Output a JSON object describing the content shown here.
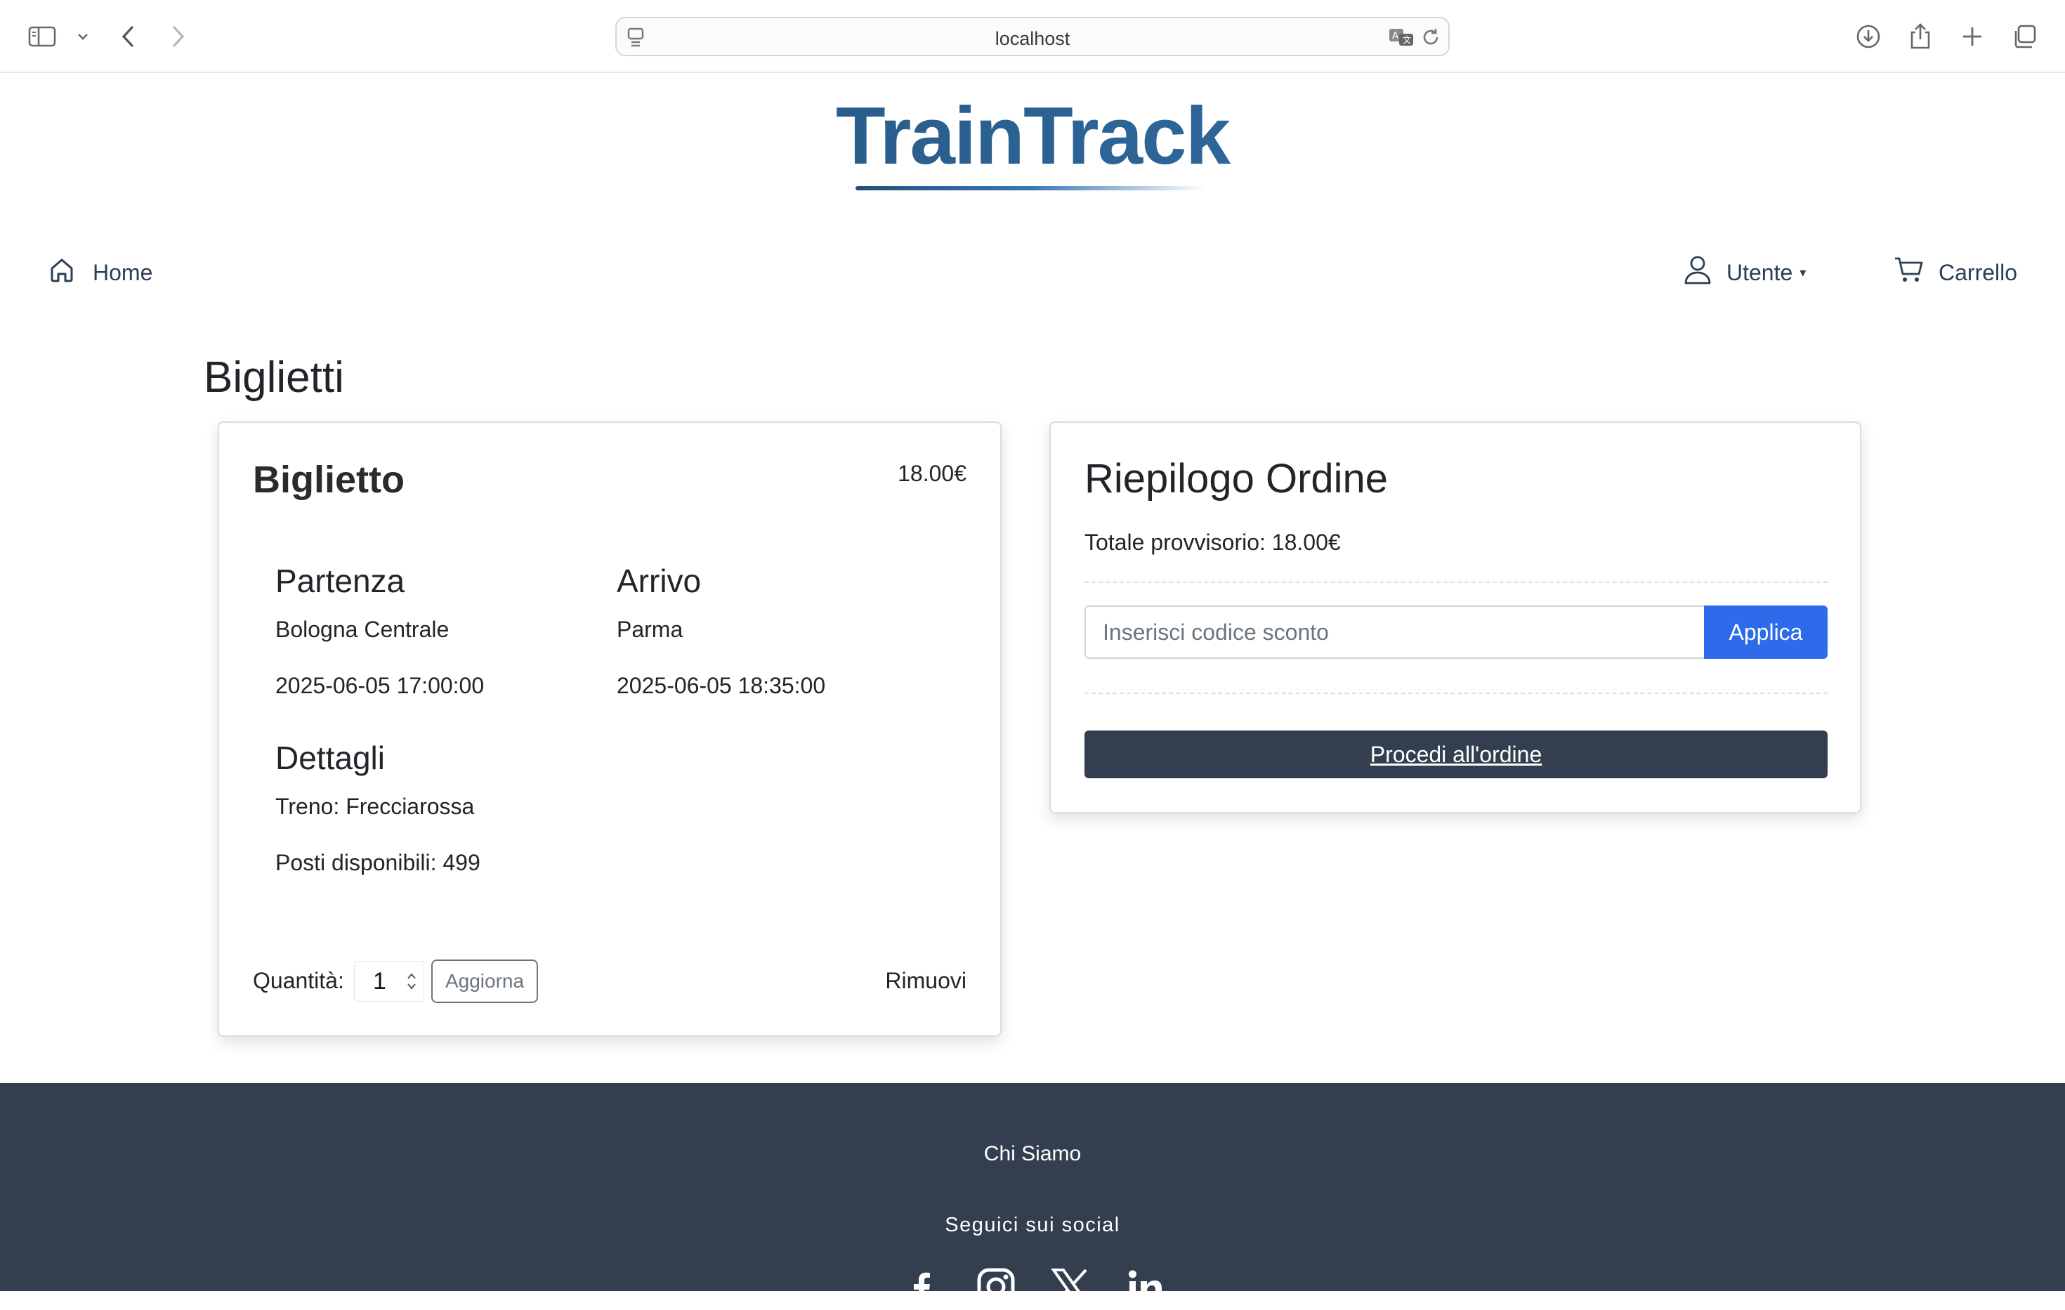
{
  "browser": {
    "url": "localhost"
  },
  "logo": {
    "text": "TrainTrack"
  },
  "nav": {
    "home_label": "Home",
    "user_label": "Utente",
    "user_caret": "▾",
    "cart_label": "Carrello"
  },
  "page": {
    "title": "Biglietti"
  },
  "ticket": {
    "title": "Biglietto",
    "price": "18.00€",
    "departure_heading": "Partenza",
    "departure_station": "Bologna Centrale",
    "departure_time": "2025-06-05 17:00:00",
    "arrival_heading": "Arrivo",
    "arrival_station": "Parma",
    "arrival_time": "2025-06-05 18:35:00",
    "details_heading": "Dettagli",
    "train": "Treno: Frecciarossa",
    "seats": "Posti disponibili: 499",
    "quantity_label": "Quantità:",
    "quantity_value": "1",
    "update_label": "Aggiorna",
    "remove_label": "Rimuovi"
  },
  "summary": {
    "title": "Riepilogo Ordine",
    "subtotal": "Totale provvisorio: 18.00€",
    "discount_placeholder": "Inserisci codice sconto",
    "apply_label": "Applica",
    "order_label": "Procedi all'ordine"
  },
  "footer": {
    "about": "Chi Siamo",
    "social_label": "Seguici sui social",
    "social_icons": [
      "facebook-icon",
      "instagram-icon",
      "x-icon",
      "linkedin-icon"
    ]
  },
  "colors": {
    "primary_button": "#2e6bea",
    "dark": "#333f4f",
    "logo_start": "#1f4a70",
    "logo_end": "#3c7ab8"
  }
}
